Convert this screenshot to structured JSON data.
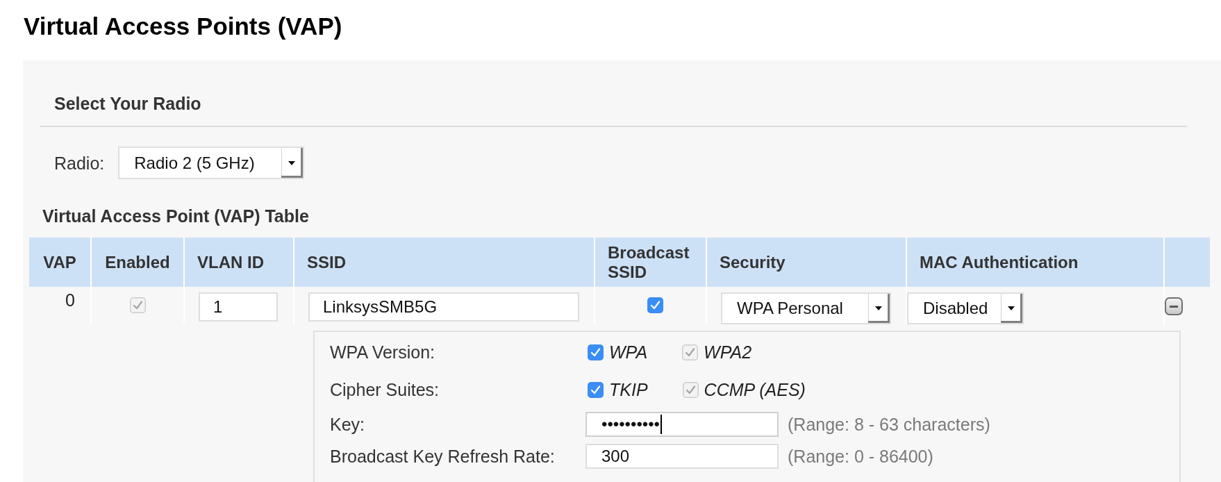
{
  "page": {
    "title": "Virtual Access Points (VAP)"
  },
  "radio_section": {
    "heading": "Select Your Radio",
    "label": "Radio:",
    "select_value": "Radio 2 (5 GHz)"
  },
  "vap_table": {
    "heading": "Virtual Access Point (VAP) Table",
    "columns": [
      "VAP",
      "Enabled",
      "VLAN ID",
      "SSID",
      "Broadcast SSID",
      "Security",
      "MAC Authentication"
    ],
    "rows": [
      {
        "vap": "0",
        "enabled": {
          "checked": true,
          "disabled": true
        },
        "vlan_id": "1",
        "ssid": "LinksysSMB5G",
        "broadcast_ssid": {
          "checked": true,
          "disabled": false
        },
        "security": "WPA Personal",
        "mac_authentication": "Disabled",
        "security_settings": [
          {
            "kind": "checkboxes",
            "label": "WPA Version:",
            "options": [
              {
                "label": "WPA",
                "checked": true,
                "disabled": false
              },
              {
                "label": "WPA2",
                "checked": true,
                "disabled": true
              }
            ]
          },
          {
            "kind": "checkboxes",
            "label": "Cipher Suites:",
            "options": [
              {
                "label": "TKIP",
                "checked": true,
                "disabled": false
              },
              {
                "label": "CCMP (AES)",
                "checked": true,
                "disabled": true
              }
            ]
          },
          {
            "kind": "field",
            "label": "Key:",
            "value": "••••••••••",
            "focused": true,
            "hint": "(Range: 8 - 63 characters)"
          },
          {
            "kind": "field",
            "label": "Broadcast Key Refresh Rate:",
            "value": "300",
            "focused": false,
            "hint": "(Range: 0 - 86400)"
          }
        ]
      }
    ]
  }
}
